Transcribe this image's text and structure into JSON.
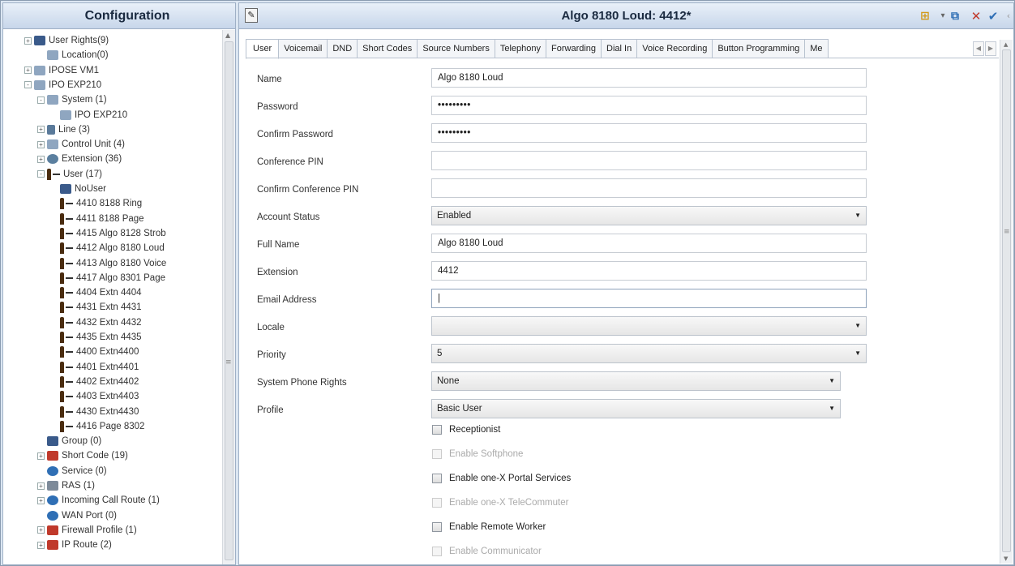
{
  "left_panel": {
    "title": "Configuration",
    "tree": [
      {
        "label": "User Rights(9)",
        "indent": 0,
        "exp": "+",
        "icon": "user-rights-icon"
      },
      {
        "label": "Location(0)",
        "indent": 1,
        "exp": "",
        "icon": "location-icon"
      },
      {
        "label": "IPOSE VM1",
        "indent": 0,
        "exp": "+",
        "icon": "server-icon"
      },
      {
        "label": "IPO EXP210",
        "indent": 0,
        "exp": "-",
        "icon": "server-icon"
      },
      {
        "label": "System (1)",
        "indent": 1,
        "exp": "-",
        "icon": "system-icon"
      },
      {
        "label": "IPO EXP210",
        "indent": 2,
        "exp": "",
        "icon": "system-icon"
      },
      {
        "label": "Line (3)",
        "indent": 1,
        "exp": "+",
        "icon": "line-icon"
      },
      {
        "label": "Control Unit (4)",
        "indent": 1,
        "exp": "+",
        "icon": "control-unit-icon"
      },
      {
        "label": "Extension (36)",
        "indent": 1,
        "exp": "+",
        "icon": "extension-icon"
      },
      {
        "label": "User (17)",
        "indent": 1,
        "exp": "-",
        "icon": "user-icon"
      },
      {
        "label": "NoUser",
        "indent": 2,
        "exp": "",
        "icon": "nouser-icon"
      },
      {
        "label": "4410 8188 Ring",
        "indent": 2,
        "exp": "",
        "icon": "user-icon"
      },
      {
        "label": "4411 8188 Page",
        "indent": 2,
        "exp": "",
        "icon": "user-icon"
      },
      {
        "label": "4415 Algo 8128 Strob",
        "indent": 2,
        "exp": "",
        "icon": "user-icon"
      },
      {
        "label": "4412 Algo 8180 Loud",
        "indent": 2,
        "exp": "",
        "icon": "user-icon"
      },
      {
        "label": "4413 Algo 8180 Voice",
        "indent": 2,
        "exp": "",
        "icon": "user-icon"
      },
      {
        "label": "4417 Algo 8301 Page",
        "indent": 2,
        "exp": "",
        "icon": "user-icon"
      },
      {
        "label": "4404 Extn 4404",
        "indent": 2,
        "exp": "",
        "icon": "user-icon"
      },
      {
        "label": "4431 Extn 4431",
        "indent": 2,
        "exp": "",
        "icon": "user-icon"
      },
      {
        "label": "4432 Extn 4432",
        "indent": 2,
        "exp": "",
        "icon": "user-icon"
      },
      {
        "label": "4435 Extn 4435",
        "indent": 2,
        "exp": "",
        "icon": "user-icon"
      },
      {
        "label": "4400 Extn4400",
        "indent": 2,
        "exp": "",
        "icon": "user-icon"
      },
      {
        "label": "4401 Extn4401",
        "indent": 2,
        "exp": "",
        "icon": "user-icon"
      },
      {
        "label": "4402 Extn4402",
        "indent": 2,
        "exp": "",
        "icon": "user-icon"
      },
      {
        "label": "4403 Extn4403",
        "indent": 2,
        "exp": "",
        "icon": "user-icon"
      },
      {
        "label": "4430 Extn4430",
        "indent": 2,
        "exp": "",
        "icon": "user-icon"
      },
      {
        "label": "4416 Page 8302",
        "indent": 2,
        "exp": "",
        "icon": "user-icon"
      },
      {
        "label": "Group (0)",
        "indent": 1,
        "exp": "",
        "icon": "group-icon"
      },
      {
        "label": "Short Code (19)",
        "indent": 1,
        "exp": "+",
        "icon": "short-code-icon"
      },
      {
        "label": "Service (0)",
        "indent": 1,
        "exp": "",
        "icon": "service-icon"
      },
      {
        "label": "RAS (1)",
        "indent": 1,
        "exp": "+",
        "icon": "ras-icon"
      },
      {
        "label": "Incoming Call Route (1)",
        "indent": 1,
        "exp": "+",
        "icon": "incoming-call-route-icon"
      },
      {
        "label": "WAN Port (0)",
        "indent": 1,
        "exp": "",
        "icon": "wan-port-icon"
      },
      {
        "label": "Firewall Profile (1)",
        "indent": 1,
        "exp": "+",
        "icon": "firewall-icon"
      },
      {
        "label": "IP Route (2)",
        "indent": 1,
        "exp": "+",
        "icon": "ip-route-icon"
      }
    ]
  },
  "right_panel": {
    "title": "Algo 8180 Loud: 4412*",
    "tabs": [
      "User",
      "Voicemail",
      "DND",
      "Short Codes",
      "Source Numbers",
      "Telephony",
      "Forwarding",
      "Dial In",
      "Voice Recording",
      "Button Programming",
      "Me"
    ],
    "form": {
      "name_label": "Name",
      "name_value": "Algo 8180 Loud",
      "password_label": "Password",
      "password_value": "•••••••••",
      "confirm_password_label": "Confirm Password",
      "confirm_password_value": "•••••••••",
      "conference_pin_label": "Conference PIN",
      "conference_pin_value": "",
      "confirm_conference_pin_label": "Confirm Conference PIN",
      "confirm_conference_pin_value": "",
      "account_status_label": "Account Status",
      "account_status_value": "Enabled",
      "full_name_label": "Full Name",
      "full_name_value": "Algo 8180 Loud",
      "extension_label": "Extension",
      "extension_value": "4412",
      "email_label": "Email Address",
      "email_value": "|",
      "locale_label": "Locale",
      "locale_value": "",
      "priority_label": "Priority",
      "priority_value": "5",
      "system_phone_rights_label": "System Phone Rights",
      "system_phone_rights_value": "None",
      "profile_label": "Profile",
      "profile_value": "Basic User"
    },
    "checkboxes": [
      {
        "label": "Receptionist",
        "enabled": true
      },
      {
        "label": "Enable Softphone",
        "enabled": false
      },
      {
        "label": "Enable one-X Portal Services",
        "enabled": true
      },
      {
        "label": "Enable one-X TeleCommuter",
        "enabled": false
      },
      {
        "label": "Enable Remote Worker",
        "enabled": true
      },
      {
        "label": "Enable Communicator",
        "enabled": false
      }
    ]
  }
}
